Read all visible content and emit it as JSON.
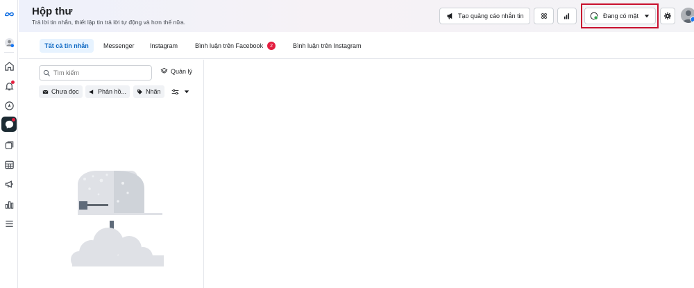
{
  "header": {
    "title": "Hộp thư",
    "subtitle": "Trả lời tin nhắn, thiết lập tin trả lời tự động và hơn thế nữa.",
    "create_ad_label": "Tạo quảng cáo nhắn tin",
    "presence_label": "Đang có mặt"
  },
  "tabs": [
    {
      "label": "Tất cả tin nhắn",
      "active": true
    },
    {
      "label": "Messenger"
    },
    {
      "label": "Instagram"
    },
    {
      "label": "Bình luận trên Facebook",
      "badge": "2"
    },
    {
      "label": "Bình luận trên Instagram"
    }
  ],
  "list": {
    "search_placeholder": "Tìm kiếm",
    "manage_label": "Quản lý",
    "filters": [
      {
        "label": "Chưa đọc",
        "icon": "envelope-icon"
      },
      {
        "label": "Phản hồ...",
        "icon": "megaphone-icon"
      },
      {
        "label": "Nhãn",
        "icon": "tag-icon"
      }
    ]
  },
  "colors": {
    "accent": "#0a66c2",
    "active_tab_bg": "#e7f3ff",
    "highlight": "#c8102e",
    "status_dot": "#31a24c",
    "badge": "#e41e3f"
  }
}
